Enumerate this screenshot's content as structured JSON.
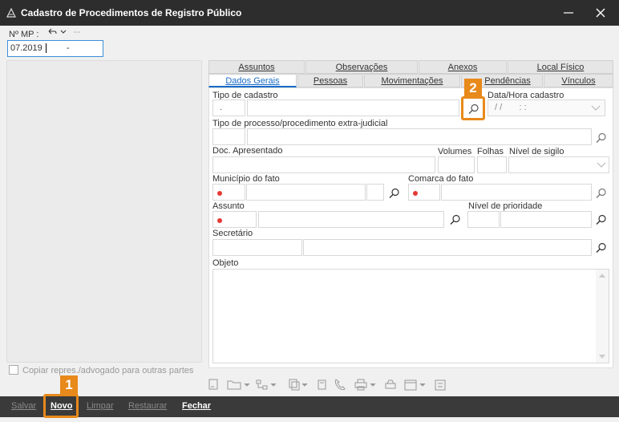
{
  "window": {
    "title": "Cadastro de Procedimentos de Registro Público"
  },
  "mp": {
    "label": "Nº MP :",
    "value": "07.2019",
    "suffix": "-"
  },
  "tabs_top": [
    "Assuntos",
    "Observações",
    "Anexos",
    "Local Físico"
  ],
  "tabs_bottom": [
    "Dados Gerais",
    "Pessoas",
    "Movimentações",
    "Pendências",
    "Vínculos"
  ],
  "fields": {
    "tipo_cadastro": {
      "label": "Tipo de cadastro",
      "code": "."
    },
    "data_hora": {
      "label": "Data/Hora cadastro",
      "value": "/ /       : :"
    },
    "tipo_processo": {
      "label": "Tipo de processo/procedimento extra-judicial"
    },
    "doc_apresentado": {
      "label": "Doc. Apresentado"
    },
    "volumes": {
      "label": "Volumes"
    },
    "folhas": {
      "label": "Folhas"
    },
    "nivel_sigilo": {
      "label": "Nível de sigilo"
    },
    "municipio": {
      "label": "Município do fato"
    },
    "comarca": {
      "label": "Comarca do fato"
    },
    "assunto": {
      "label": "Assunto"
    },
    "nivel_prioridade": {
      "label": "Nível de prioridade"
    },
    "secretario": {
      "label": "Secretário"
    },
    "objeto": {
      "label": "Objeto"
    }
  },
  "copy_checkbox": {
    "label": "Copiar repres./advogado para outras partes",
    "checked": false
  },
  "actions": {
    "salvar": "Salvar",
    "novo": "Novo",
    "limpar": "Limpar",
    "restaurar": "Restaurar",
    "fechar": "Fechar"
  },
  "callouts": {
    "one": "1",
    "two": "2"
  },
  "colors": {
    "accent": "#e8891b",
    "titlebar": "#2d2d2d",
    "required": "#e53935",
    "active_tab": "#1a6cc8"
  }
}
